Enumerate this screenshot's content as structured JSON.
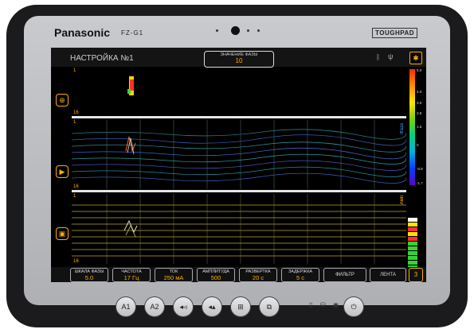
{
  "device": {
    "brand": "Panasonic",
    "model": "FZ-G1",
    "series": "TOUGHPAD",
    "hardware_buttons": [
      "A1",
      "A2",
      "◂◃",
      "◂▴",
      "⊞",
      "⧉"
    ],
    "colors": {
      "body": "#1b1b1d",
      "bezel": "#b8b9bd"
    }
  },
  "app": {
    "title": "НАСТРОЙКА №1",
    "phase": {
      "label": "ЗНАЧЕНИЕ ФАЗЫ",
      "value": "10"
    },
    "status_icons": [
      "bluetooth-icon",
      "usb-icon"
    ],
    "settings_icon": "gear-icon",
    "side_buttons": [
      "crosshair-icon",
      "play-icon",
      "save-icon"
    ],
    "panels": {
      "top": {
        "start": "1",
        "end": "16"
      },
      "middle": {
        "start": "1",
        "end": "16",
        "side_label": "Фаза"
      },
      "bottom": {
        "start": "1",
        "end": "16",
        "side_label": "Амп"
      }
    },
    "color_scale": {
      "labels": [
        "5.0",
        "4.0",
        "3.0",
        "2.8",
        "1.5",
        "0",
        "-0.8",
        "-1.7"
      ]
    },
    "level_indicator": {
      "colors": [
        "#ffffff",
        "#ffe000",
        "#ff3030",
        "#ffe000",
        "#ff3030",
        "#3ad03a",
        "#3ad03a",
        "#3ad03a",
        "#3ad03a",
        "#3ad03a",
        "#3ad03a"
      ]
    },
    "accent": "#ffb000",
    "controls": [
      {
        "label": "ШКАЛА ФАЗЫ",
        "value": "5.0"
      },
      {
        "label": "ЧАСТОТА",
        "value": "17 Гц"
      },
      {
        "label": "ТОК",
        "value": "250 мА"
      },
      {
        "label": "АМПЛИТУДА",
        "value": "500"
      },
      {
        "label": "РАЗВЕРТКА",
        "value": "20 с"
      },
      {
        "label": "ЗАДЕРЖКА",
        "value": "5 с"
      }
    ],
    "filter_label": "ФИЛЬТР",
    "tape_label": "ЛЕНТА",
    "page_number": "3"
  }
}
